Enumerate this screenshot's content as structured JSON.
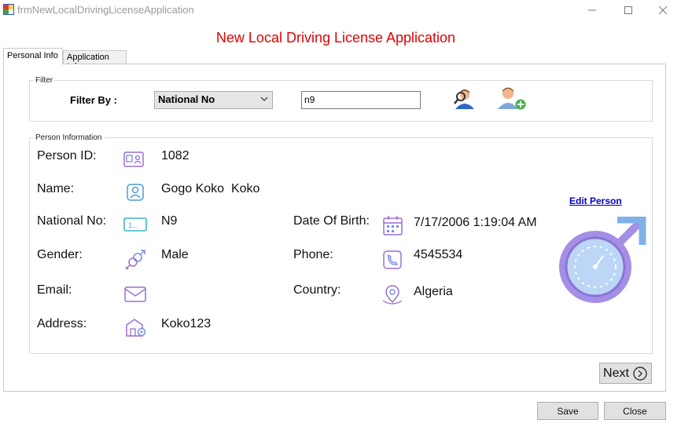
{
  "window": {
    "title": "frmNewLocalDrivingLicenseApplication"
  },
  "form_title": "New Local Driving License Application",
  "tabs": [
    {
      "label": "Personal Info",
      "active": true
    },
    {
      "label": "Application Info",
      "active": false
    }
  ],
  "filter": {
    "group_caption": "Filter",
    "label": "Filter By :",
    "selected_option": "National No",
    "search_value": "n9"
  },
  "person": {
    "group_caption": "Person Information",
    "fields": {
      "person_id": {
        "label": "Person ID:",
        "value": "1082"
      },
      "name": {
        "label": "Name:",
        "value": "Gogo Koko  Koko"
      },
      "national_no": {
        "label": "National No:",
        "value": "N9"
      },
      "gender": {
        "label": "Gender:",
        "value": "Male"
      },
      "email": {
        "label": "Email:",
        "value": ""
      },
      "address": {
        "label": "Address:",
        "value": "Koko123"
      },
      "date_of_birth": {
        "label": "Date Of Birth:",
        "value": "7/17/2006 1:19:04 AM"
      },
      "phone": {
        "label": "Phone:",
        "value": "4545534"
      },
      "country": {
        "label": "Country:",
        "value": "Algeria"
      }
    },
    "edit_link": "Edit Person"
  },
  "buttons": {
    "next": "Next",
    "save": "Save",
    "close": "Close"
  },
  "colors": {
    "title_red": "#e00000",
    "link_blue": "#0000cc",
    "icon_purple": "#9b6fd3",
    "male_symbol": "#7a8ce6"
  },
  "icons": [
    "app-icon",
    "minimize-icon",
    "maximize-icon",
    "close-icon",
    "find-person-icon",
    "add-person-icon",
    "id-card-icon",
    "name-icon",
    "national-no-icon",
    "gender-icon",
    "email-icon",
    "address-icon",
    "calendar-icon",
    "phone-icon",
    "country-icon",
    "male-symbol-icon",
    "next-arrow-icon"
  ]
}
